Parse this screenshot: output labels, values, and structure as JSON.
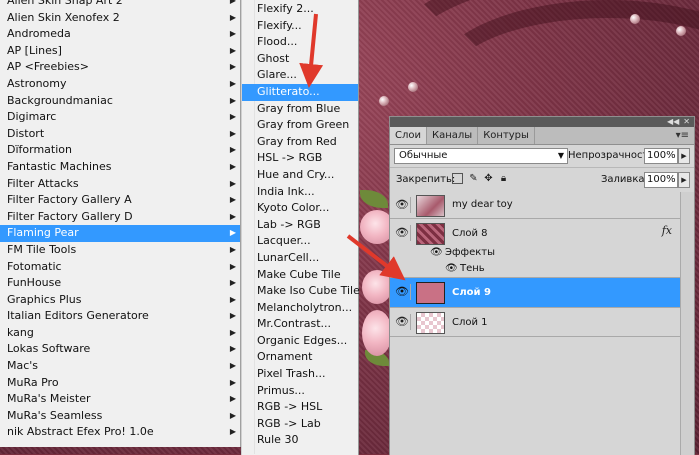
{
  "left_menu": {
    "items": [
      {
        "label": "Alien Skin Snap Art 2",
        "has_submenu": true
      },
      {
        "label": "Alien Skin Xenofex 2",
        "has_submenu": true
      },
      {
        "label": "Andromeda",
        "has_submenu": true
      },
      {
        "label": "AP [Lines]",
        "has_submenu": true
      },
      {
        "label": "AP <Freebies>",
        "has_submenu": true
      },
      {
        "label": "Astronomy",
        "has_submenu": true
      },
      {
        "label": "Backgroundmaniac",
        "has_submenu": true
      },
      {
        "label": "Digimarc",
        "has_submenu": true
      },
      {
        "label": "Distort",
        "has_submenu": true
      },
      {
        "label": "Dïformation",
        "has_submenu": true
      },
      {
        "label": "Fantastic Machines",
        "has_submenu": true
      },
      {
        "label": "Filter Attacks",
        "has_submenu": true
      },
      {
        "label": "Filter Factory Gallery A",
        "has_submenu": true
      },
      {
        "label": "Filter Factory Gallery D",
        "has_submenu": true
      },
      {
        "label": "Flaming Pear",
        "has_submenu": true,
        "selected": true
      },
      {
        "label": "FM Tile Tools",
        "has_submenu": true
      },
      {
        "label": "Fotomatic",
        "has_submenu": true
      },
      {
        "label": "FunHouse",
        "has_submenu": true
      },
      {
        "label": "Graphics Plus",
        "has_submenu": true
      },
      {
        "label": "Italian Editors Generatore",
        "has_submenu": true
      },
      {
        "label": "kang",
        "has_submenu": true
      },
      {
        "label": "Lokas Software",
        "has_submenu": true
      },
      {
        "label": "Mac's",
        "has_submenu": true
      },
      {
        "label": "MuRa Pro",
        "has_submenu": true
      },
      {
        "label": "MuRa's Meister",
        "has_submenu": true
      },
      {
        "label": "MuRa's Seamless",
        "has_submenu": true
      },
      {
        "label": "nik Abstract Efex Pro! 1.0e",
        "has_submenu": true
      }
    ],
    "arrow_glyph": "▶"
  },
  "submenu": {
    "items": [
      {
        "label": "Flexify 2..."
      },
      {
        "label": "Flexify..."
      },
      {
        "label": "Flood..."
      },
      {
        "label": "Ghost"
      },
      {
        "label": "Glare..."
      },
      {
        "label": "Glitterato...",
        "selected": true
      },
      {
        "label": "Gray from Blue"
      },
      {
        "label": "Gray from Green"
      },
      {
        "label": "Gray from Red"
      },
      {
        "label": "HSL -> RGB"
      },
      {
        "label": "Hue and Cry..."
      },
      {
        "label": "India Ink..."
      },
      {
        "label": "Kyoto Color..."
      },
      {
        "label": "Lab -> RGB"
      },
      {
        "label": "Lacquer..."
      },
      {
        "label": "LunarCell..."
      },
      {
        "label": "Make Cube Tile"
      },
      {
        "label": "Make Iso Cube Tile"
      },
      {
        "label": "Melancholytron..."
      },
      {
        "label": "Mr.Contrast..."
      },
      {
        "label": "Organic Edges..."
      },
      {
        "label": "Ornament"
      },
      {
        "label": "Pixel Trash..."
      },
      {
        "label": "Primus..."
      },
      {
        "label": "RGB -> HSL"
      },
      {
        "label": "RGB -> Lab"
      },
      {
        "label": "Rule 30"
      }
    ]
  },
  "layers_panel": {
    "tabs": [
      "Слои",
      "Каналы",
      "Контуры"
    ],
    "blend_mode": "Обычные",
    "opacity_label": "Непрозрачность:",
    "opacity_value": "100%",
    "lock_label": "Закрепить:",
    "fill_label": "Заливка:",
    "fill_value": "100%",
    "layers": [
      {
        "name": "my dear toy",
        "visible": true
      },
      {
        "name": "Слой 8",
        "visible": true,
        "fx": "fx"
      },
      {
        "name": "Слой 9",
        "visible": true,
        "selected": true
      },
      {
        "name": "Слой 1",
        "visible": true
      }
    ],
    "effects_label": "Эффекты",
    "shadow_label": "Тень"
  },
  "colors": {
    "menu_bg": "#f0f0f0",
    "selection": "#3399ff",
    "arrow_red": "#e0392b",
    "canvas": "#7d3346"
  }
}
